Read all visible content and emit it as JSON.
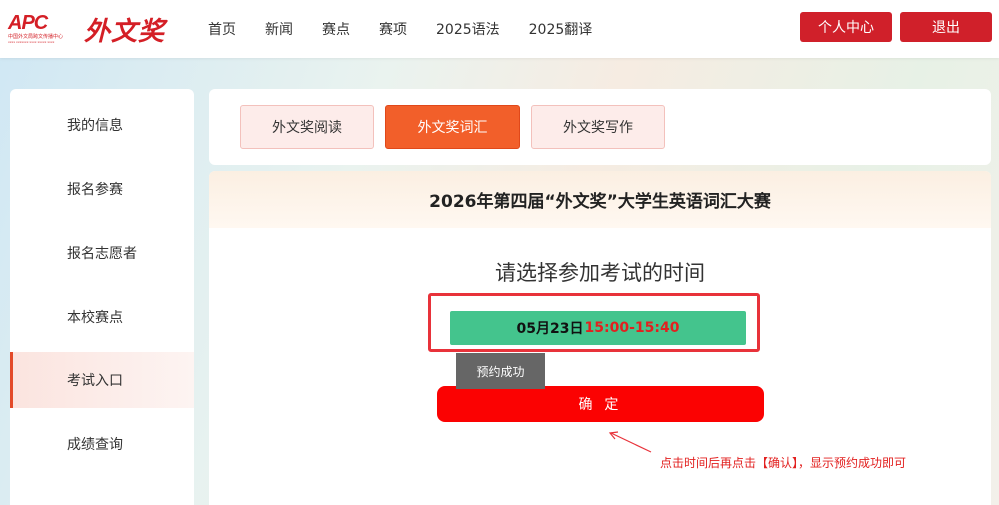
{
  "header": {
    "logo": {
      "apc": "APC",
      "org": "中国外文局跨文传播中心",
      "org_en": "xxxx xxxxxxx xxxx xxxxx xxxx",
      "name": "外文奖"
    },
    "nav": [
      "首页",
      "新闻",
      "赛点",
      "赛项",
      "2025语法",
      "2025翻译"
    ],
    "profile_label": "个人中心",
    "logout_label": "退出"
  },
  "sidebar": {
    "items": [
      {
        "label": "我的信息",
        "active": false
      },
      {
        "label": "报名参赛",
        "active": false
      },
      {
        "label": "报名志愿者",
        "active": false
      },
      {
        "label": "本校赛点",
        "active": false
      },
      {
        "label": "考试入口",
        "active": true
      },
      {
        "label": "成绩查询",
        "active": false
      }
    ]
  },
  "tabs": [
    {
      "label": "外文奖阅读",
      "selected": false
    },
    {
      "label": "外文奖词汇",
      "selected": true
    },
    {
      "label": "外文奖写作",
      "selected": false
    }
  ],
  "main": {
    "title": "2026年第四届“外文奖”大学生英语词汇大赛",
    "prompt": "请选择参加考试的时间",
    "time_slot": {
      "date": "05月23日",
      "range": "15:00-15:40"
    },
    "toast": "预约成功",
    "confirm_label": "确 定",
    "annotation": "点击时间后再点击【确认】，显示预约成功即可"
  },
  "colors": {
    "brand_red": "#d0202a",
    "tab_selected": "#f25f2a",
    "time_green": "#44c48d",
    "confirm_red": "#fb0202",
    "annotation_red": "#e2201f"
  }
}
